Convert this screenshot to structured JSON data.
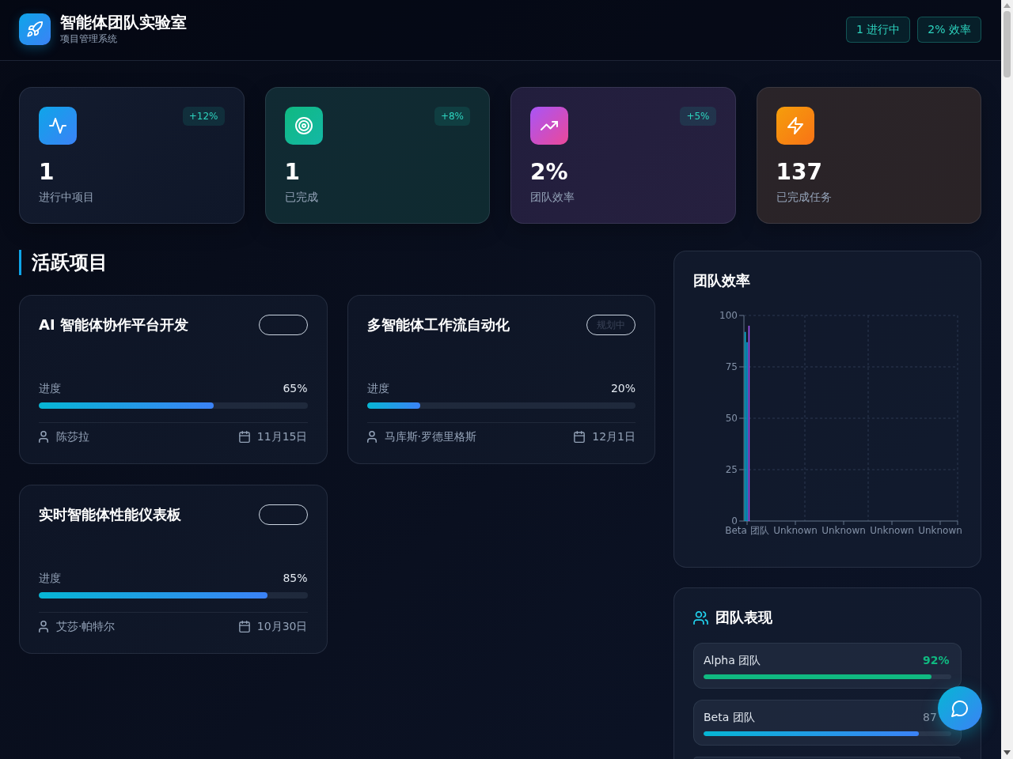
{
  "header": {
    "title": "智能体团队实验室",
    "subtitle": "项目管理系统",
    "badges": [
      "1 进行中",
      "2% 效率"
    ]
  },
  "stats": [
    {
      "kind": "active",
      "value": "1",
      "label": "进行中项目",
      "change": "+12%"
    },
    {
      "kind": "done",
      "value": "1",
      "label": "已完成",
      "change": "+8%"
    },
    {
      "kind": "efficiency",
      "value": "2%",
      "label": "团队效率",
      "change": "+5%"
    },
    {
      "kind": "tasks",
      "value": "137",
      "label": "已完成任务"
    }
  ],
  "active_projects": {
    "title": "活跃项目",
    "projects": [
      {
        "title": "AI 智能体协作平台开发",
        "progress_label": "进度",
        "progress_text": "65%",
        "level": 0.65,
        "owner": "陈莎拉",
        "due": "11月15日"
      },
      {
        "title": "多智能体工作流自动化",
        "status": "规划中",
        "progress_label": "进度",
        "progress_text": "20%",
        "level": 0.2,
        "owner": "马库斯·罗德里格斯",
        "due": "12月1日"
      },
      {
        "title": "实时智能体性能仪表板",
        "progress_label": "进度",
        "progress_text": "85%",
        "level": 0.85,
        "owner": "艾莎·帕特尔",
        "due": "10月30日"
      }
    ]
  },
  "efficiency_panel": {
    "title": "团队效率",
    "chart_data": {
      "type": "bar",
      "categories": [
        "Beta 团队",
        "Unknown",
        "Unknown",
        "Unknown",
        "Unknown"
      ],
      "series": [
        {
          "color": "#06b6d4",
          "values": [
            92,
            null,
            null,
            null,
            null
          ]
        },
        {
          "color": "#0ea5e9",
          "values": [
            87,
            null,
            null,
            null,
            null
          ]
        },
        {
          "color": "#a855f7",
          "values": [
            95,
            null,
            null,
            null,
            null
          ]
        }
      ],
      "ylim": [
        0,
        100
      ],
      "yticks": [
        0,
        25,
        50,
        75,
        100
      ],
      "grid": true
    }
  },
  "team_performance": {
    "title": "团队表现",
    "teams": [
      {
        "name": "Alpha 团队",
        "score": "92%",
        "level": 0.92,
        "highlight": true
      },
      {
        "name": "Beta 团队",
        "score": "87",
        "level": 0.87,
        "highlight": false
      }
    ],
    "more_below": true
  }
}
